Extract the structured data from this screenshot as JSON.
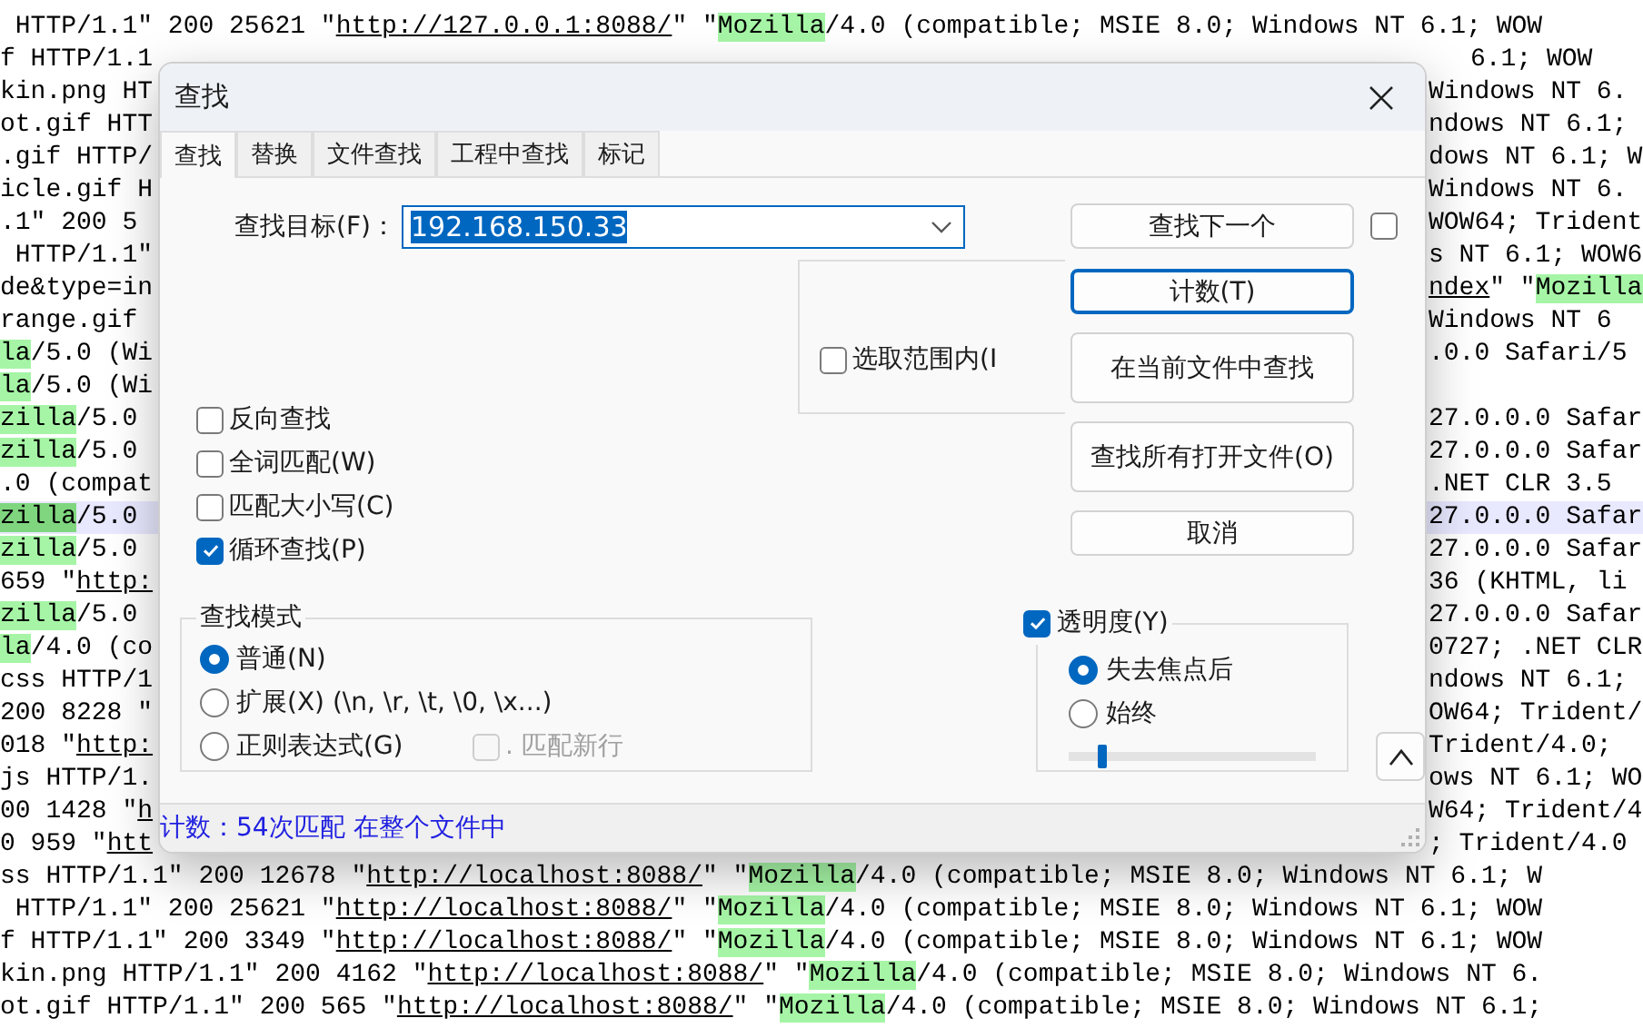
{
  "editor": {
    "lines": [
      {
        "kind": "full",
        "current": false,
        "segments": [
          {
            "kind": "text",
            "text": " HTTP/1.1\" 200 25621 \""
          },
          {
            "kind": "link",
            "text": "http://127.0.0.1:8088/"
          },
          {
            "kind": "text",
            "text": "\" \""
          },
          {
            "kind": "match",
            "text": "Mozilla"
          },
          {
            "kind": "text",
            "text": "/4.0 (compatible; MSIE 8.0; Windows NT 6.1; WOW"
          }
        ]
      },
      {
        "kind": "split",
        "current": false,
        "left": [
          {
            "kind": "text",
            "text": "f HTTP/1.1"
          }
        ],
        "right": [
          {
            "kind": "text",
            "text": "6.1; WOW"
          }
        ]
      },
      {
        "kind": "split",
        "current": false,
        "left": [
          {
            "kind": "text",
            "text": "kin.png HT"
          }
        ],
        "right": [
          {
            "kind": "text",
            "text": "Windows NT 6."
          }
        ]
      },
      {
        "kind": "split",
        "current": false,
        "left": [
          {
            "kind": "text",
            "text": "ot.gif HTT"
          }
        ],
        "right": [
          {
            "kind": "text",
            "text": "ndows NT 6.1;"
          }
        ]
      },
      {
        "kind": "split",
        "current": false,
        "left": [
          {
            "kind": "text",
            "text": ".gif HTTP/"
          }
        ],
        "right": [
          {
            "kind": "text",
            "text": "dows NT 6.1; W"
          }
        ]
      },
      {
        "kind": "split",
        "current": false,
        "left": [
          {
            "kind": "text",
            "text": "icle.gif H"
          }
        ],
        "right": [
          {
            "kind": "text",
            "text": "Windows NT 6."
          }
        ]
      },
      {
        "kind": "split",
        "current": false,
        "left": [
          {
            "kind": "text",
            "text": ".1\" 200 5"
          }
        ],
        "right": [
          {
            "kind": "text",
            "text": "WOW64; Trident"
          }
        ]
      },
      {
        "kind": "split",
        "current": false,
        "left": [
          {
            "kind": "text",
            "text": " HTTP/1.1\""
          }
        ],
        "right": [
          {
            "kind": "text",
            "text": "s NT 6.1; WOW6"
          }
        ]
      },
      {
        "kind": "split",
        "current": false,
        "left": [
          {
            "kind": "text",
            "text": "de&type=in"
          }
        ],
        "right": [
          {
            "kind": "link",
            "text": "ndex"
          },
          {
            "kind": "text",
            "text": "\" \""
          },
          {
            "kind": "match",
            "text": "Mozilla"
          }
        ]
      },
      {
        "kind": "split",
        "current": false,
        "left": [
          {
            "kind": "text",
            "text": "range.gif"
          }
        ],
        "right": [
          {
            "kind": "text",
            "text": "Windows NT 6"
          }
        ]
      },
      {
        "kind": "split",
        "current": false,
        "left": [
          {
            "kind": "match",
            "text": "la"
          },
          {
            "kind": "text",
            "text": "/5.0 (Wi"
          }
        ],
        "right": [
          {
            "kind": "text",
            "text": ".0.0 Safari/5"
          }
        ]
      },
      {
        "kind": "split",
        "current": false,
        "left": [
          {
            "kind": "match",
            "text": "la"
          },
          {
            "kind": "text",
            "text": "/5.0 (Wi"
          }
        ]
      },
      {
        "kind": "split",
        "current": false,
        "left": [
          {
            "kind": "match",
            "text": "zilla"
          },
          {
            "kind": "text",
            "text": "/5.0"
          }
        ],
        "right": [
          {
            "kind": "text",
            "text": "27.0.0.0 Safar"
          }
        ]
      },
      {
        "kind": "split",
        "current": false,
        "left": [
          {
            "kind": "match",
            "text": "zilla"
          },
          {
            "kind": "text",
            "text": "/5.0"
          }
        ],
        "right": [
          {
            "kind": "text",
            "text": "27.0.0.0 Safar"
          }
        ]
      },
      {
        "kind": "split",
        "current": false,
        "left": [
          {
            "kind": "text",
            "text": ".0 (compat"
          }
        ],
        "right": [
          {
            "kind": "text",
            "text": ".NET CLR 3.5"
          }
        ]
      },
      {
        "kind": "split",
        "current": true,
        "left": [
          {
            "kind": "match",
            "text": "zilla"
          },
          {
            "kind": "text",
            "text": "/5.0"
          }
        ],
        "right": [
          {
            "kind": "text",
            "text": "27.0.0.0 Safar"
          }
        ]
      },
      {
        "kind": "split",
        "current": false,
        "left": [
          {
            "kind": "match",
            "text": "zilla"
          },
          {
            "kind": "text",
            "text": "/5.0"
          }
        ],
        "right": [
          {
            "kind": "text",
            "text": "27.0.0.0 Safar"
          }
        ]
      },
      {
        "kind": "split",
        "current": false,
        "left": [
          {
            "kind": "text",
            "text": "659 \""
          },
          {
            "kind": "link",
            "text": "http:"
          }
        ],
        "right": [
          {
            "kind": "text",
            "text": "36 (KHTML, li"
          }
        ]
      },
      {
        "kind": "split",
        "current": false,
        "left": [
          {
            "kind": "match",
            "text": "zilla"
          },
          {
            "kind": "text",
            "text": "/5.0"
          }
        ],
        "right": [
          {
            "kind": "text",
            "text": "27.0.0.0 Safar"
          }
        ]
      },
      {
        "kind": "split",
        "current": false,
        "left": [
          {
            "kind": "match",
            "text": "la"
          },
          {
            "kind": "text",
            "text": "/4.0 (co"
          }
        ],
        "right": [
          {
            "kind": "text",
            "text": "0727; .NET CLR"
          }
        ]
      },
      {
        "kind": "split",
        "current": false,
        "left": [
          {
            "kind": "text",
            "text": "css HTTP/1"
          }
        ],
        "right": [
          {
            "kind": "text",
            "text": "ndows NT 6.1;"
          }
        ]
      },
      {
        "kind": "split",
        "current": false,
        "left": [
          {
            "kind": "text",
            "text": "200 8228 \""
          }
        ],
        "right": [
          {
            "kind": "text",
            "text": "OW64; Trident/"
          }
        ]
      },
      {
        "kind": "split",
        "current": false,
        "left": [
          {
            "kind": "text",
            "text": "018 \""
          },
          {
            "kind": "link",
            "text": "http:"
          }
        ],
        "right": [
          {
            "kind": "text",
            "text": "Trident/4.0;"
          }
        ]
      },
      {
        "kind": "split",
        "current": false,
        "left": [
          {
            "kind": "text",
            "text": "js HTTP/1."
          }
        ],
        "right": [
          {
            "kind": "text",
            "text": "ows NT 6.1; WO"
          }
        ]
      },
      {
        "kind": "split",
        "current": false,
        "left": [
          {
            "kind": "text",
            "text": "00 1428 \""
          },
          {
            "kind": "link",
            "text": "h"
          }
        ],
        "right": [
          {
            "kind": "text",
            "text": "W64; Trident/4"
          }
        ]
      },
      {
        "kind": "split",
        "current": false,
        "left": [
          {
            "kind": "text",
            "text": "0 959 \""
          },
          {
            "kind": "link",
            "text": "htt"
          }
        ],
        "right": [
          {
            "kind": "text",
            "text": "; Trident/4.0"
          }
        ]
      },
      {
        "kind": "full",
        "current": false,
        "segments": [
          {
            "kind": "text",
            "text": "ss HTTP/1.1\" 200 12678 \""
          },
          {
            "kind": "link",
            "text": "http://localhost:8088/"
          },
          {
            "kind": "text",
            "text": "\" \""
          },
          {
            "kind": "match",
            "text": "Mozilla"
          },
          {
            "kind": "text",
            "text": "/4.0 (compatible; MSIE 8.0; Windows NT 6.1; W"
          }
        ]
      },
      {
        "kind": "full",
        "current": false,
        "segments": [
          {
            "kind": "text",
            "text": " HTTP/1.1\" 200 25621 \""
          },
          {
            "kind": "link",
            "text": "http://localhost:8088/"
          },
          {
            "kind": "text",
            "text": "\" \""
          },
          {
            "kind": "match",
            "text": "Mozilla"
          },
          {
            "kind": "text",
            "text": "/4.0 (compatible; MSIE 8.0; Windows NT 6.1; WOW"
          }
        ]
      },
      {
        "kind": "full",
        "current": false,
        "segments": [
          {
            "kind": "text",
            "text": "f HTTP/1.1\" 200 3349 \""
          },
          {
            "kind": "link",
            "text": "http://localhost:8088/"
          },
          {
            "kind": "text",
            "text": "\" \""
          },
          {
            "kind": "match",
            "text": "Mozilla"
          },
          {
            "kind": "text",
            "text": "/4.0 (compatible; MSIE 8.0; Windows NT 6.1; WOW"
          }
        ]
      },
      {
        "kind": "full",
        "current": false,
        "segments": [
          {
            "kind": "text",
            "text": "kin.png HTTP/1.1\" 200 4162 \""
          },
          {
            "kind": "link",
            "text": "http://localhost:8088/"
          },
          {
            "kind": "text",
            "text": "\" \""
          },
          {
            "kind": "match",
            "text": "Mozilla"
          },
          {
            "kind": "text",
            "text": "/4.0 (compatible; MSIE 8.0; Windows NT 6."
          }
        ]
      },
      {
        "kind": "full",
        "current": false,
        "segments": [
          {
            "kind": "text",
            "text": "ot.gif HTTP/1.1\" 200 565 \""
          },
          {
            "kind": "link",
            "text": "http://localhost:8088/"
          },
          {
            "kind": "text",
            "text": "\" \""
          },
          {
            "kind": "match",
            "text": "Mozilla"
          },
          {
            "kind": "text",
            "text": "/4.0 (compatible; MSIE 8.0; Windows NT 6.1;"
          }
        ]
      }
    ]
  },
  "dialog": {
    "title": "查找",
    "tabs": [
      {
        "label": "查找",
        "selected": true
      },
      {
        "label": "替换",
        "selected": false
      },
      {
        "label": "文件查找",
        "selected": false
      },
      {
        "label": "工程中查找",
        "selected": false
      },
      {
        "label": "标记",
        "selected": false
      }
    ],
    "find_label": "查找目标(F)：",
    "find_value": "192.168.150.33",
    "side_checkbox": {
      "checked": false
    },
    "in_selection": {
      "label": "选取范围内(I",
      "checked": false
    },
    "options": [
      {
        "label": "反向查找",
        "checked": false
      },
      {
        "label": "全词匹配(W)",
        "checked": false
      },
      {
        "label": "匹配大小写(C)",
        "checked": false
      },
      {
        "label": "循环查找(P)",
        "checked": true
      }
    ],
    "buttons": [
      {
        "label": "查找下一个",
        "focused": false
      },
      {
        "label": "计数(T)",
        "focused": true
      },
      {
        "label": "在当前文件中查找",
        "focused": false
      },
      {
        "label": "查找所有打开文件(O)",
        "focused": false
      },
      {
        "label": "取消",
        "focused": false
      }
    ],
    "search_mode": {
      "title": "查找模式",
      "modes": [
        {
          "label": "普通(N)",
          "selected": true
        },
        {
          "label": "扩展(X) (\\n, \\r, \\t, \\0, \\x...)",
          "selected": false
        },
        {
          "label": "正则表达式(G)",
          "selected": false
        }
      ],
      "newline_option": {
        "label": ". 匹配新行",
        "checked": false,
        "disabled": true
      }
    },
    "transparency": {
      "label": "透明度(Y)",
      "checked": true,
      "modes": [
        {
          "label": "失去焦点后",
          "selected": true
        },
        {
          "label": "始终",
          "selected": false
        }
      ],
      "level": 0.12
    },
    "status": "计数：54次匹配 在整个文件中"
  }
}
